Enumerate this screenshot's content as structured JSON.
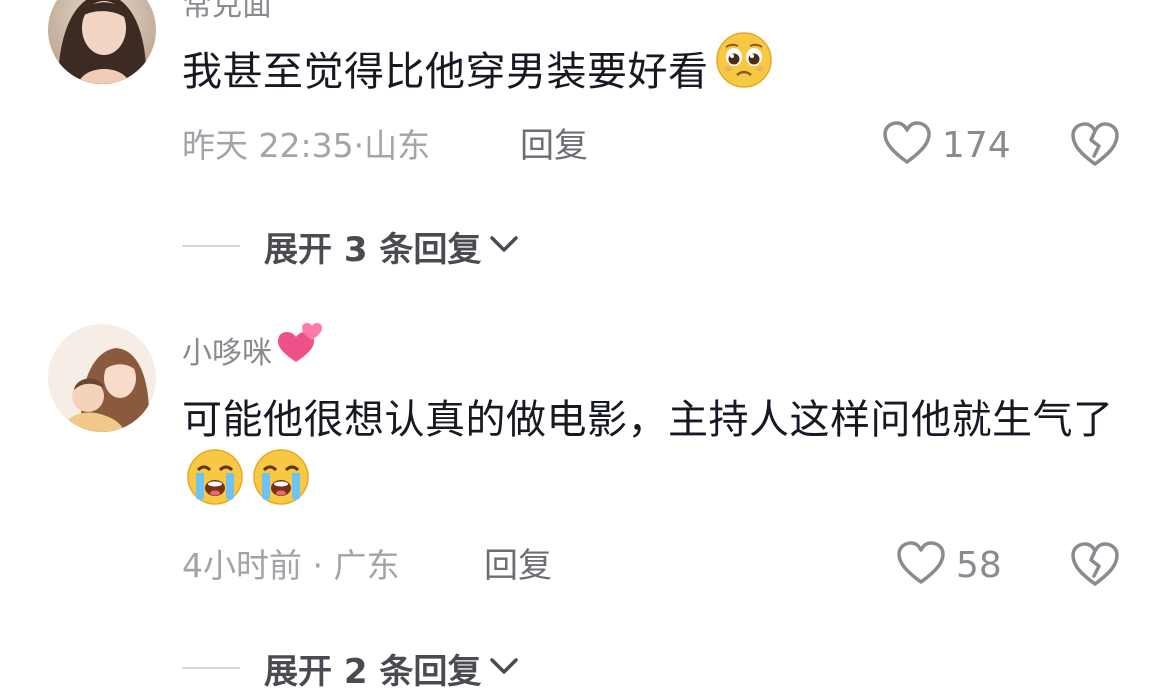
{
  "comments": [
    {
      "username": "常克面",
      "text": "我甚至觉得比他穿男装要好看",
      "emojis": [
        "pleading-face"
      ],
      "time": "昨天 22:35",
      "location": "山东",
      "reply_label": "回复",
      "likes": "174",
      "expand_label": "展开 3 条回复"
    },
    {
      "username": "小哆咪",
      "username_emoji": "two-hearts",
      "text": "可能他很想认真的做电影，主持人这样问他就生气了",
      "emojis": [
        "loudly-crying-face",
        "loudly-crying-face"
      ],
      "time": "4小时前",
      "location": "广东",
      "reply_label": "回复",
      "likes": "58",
      "expand_label": "展开 2 条回复"
    }
  ],
  "colors": {
    "text": "#161823",
    "secondary": "#8a8b91",
    "meta": "#a3a4a9",
    "expand": "#4a4b52"
  },
  "icons": [
    "heart-outline-icon",
    "broken-heart-icon",
    "chevron-down-icon"
  ]
}
